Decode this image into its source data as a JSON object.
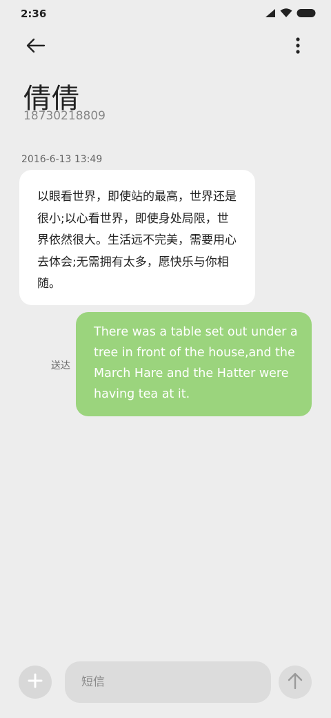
{
  "status_bar": {
    "time": "2:36",
    "icons": [
      "signal-icon",
      "wifi-icon",
      "battery-icon"
    ]
  },
  "header": {
    "back_icon": "arrow-left-icon",
    "more_icon": "more-vertical-icon",
    "contact_name": "倩倩",
    "contact_number": "18730218809"
  },
  "messages": {
    "timestamp": "2016-6-13 13:49",
    "incoming": {
      "text": "以眼看世界，即使站的最高，世界还是很小;以心看世界，即使身处局限，世界依然很大。生活远不完美，需要用心去体会;无需拥有太多，愿快乐与你相随。"
    },
    "outgoing": {
      "text": "There was a table set out under a tree in front of the house,and the March Hare and the Hatter were having tea at it.",
      "status": "送达"
    }
  },
  "composer": {
    "add_icon": "plus-icon",
    "placeholder": "短信",
    "value": "",
    "send_icon": "arrow-up-icon"
  },
  "colors": {
    "background": "#ededed",
    "incoming_bubble": "#ffffff",
    "outgoing_bubble": "#9bd47d",
    "outgoing_text": "#ffffff"
  }
}
